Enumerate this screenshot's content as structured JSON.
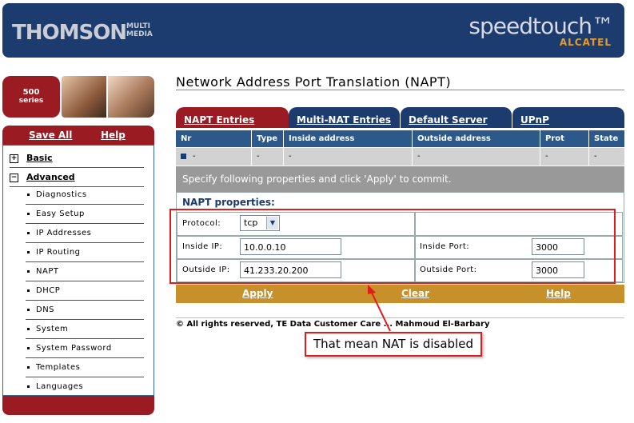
{
  "header": {
    "brand_left": "THOMSON",
    "brand_left_sub": "MULTI MEDIA",
    "brand_right": "speedtouch™",
    "brand_right_sub": "ALCATEL"
  },
  "sidebar": {
    "series_num": "500",
    "series_word": "series",
    "save_all": "Save All",
    "help": "Help",
    "basic": "Basic",
    "advanced": "Advanced",
    "items": [
      "Diagnostics",
      "Easy Setup",
      "IP Addresses",
      "IP Routing",
      "NAPT",
      "DHCP",
      "DNS",
      "System",
      "System Password",
      "Templates",
      "Languages"
    ]
  },
  "main": {
    "title": "Network Address Port Translation (NAPT)",
    "tabs": [
      "NAPT Entries",
      "Multi-NAT Entries",
      "Default Server",
      "UPnP"
    ],
    "columns": [
      "Nr",
      "Type",
      "Inside address",
      "Outside address",
      "Prot",
      "State"
    ],
    "row": [
      "-",
      "-",
      "-",
      "-",
      "-",
      "-"
    ],
    "instruction": "Specify following properties and click 'Apply' to commit.",
    "props_title": "NAPT properties:",
    "protocol_label": "Protocol:",
    "protocol_value": "tcp",
    "inside_ip_label": "Inside IP:",
    "inside_ip_value": "10.0.0.10",
    "outside_ip_label": "Outside IP:",
    "outside_ip_value": "41.233.20.200",
    "inside_port_label": "Inside Port:",
    "inside_port_value": "3000",
    "outside_port_label": "Outside Port:",
    "outside_port_value": "3000",
    "apply": "Apply",
    "clear": "Clear",
    "help": "Help",
    "copyright": "© All rights reserved, TE Data Customer Care ... Mahmoud El-Barbary"
  },
  "annotation": {
    "note": "That mean NAT is disabled"
  }
}
